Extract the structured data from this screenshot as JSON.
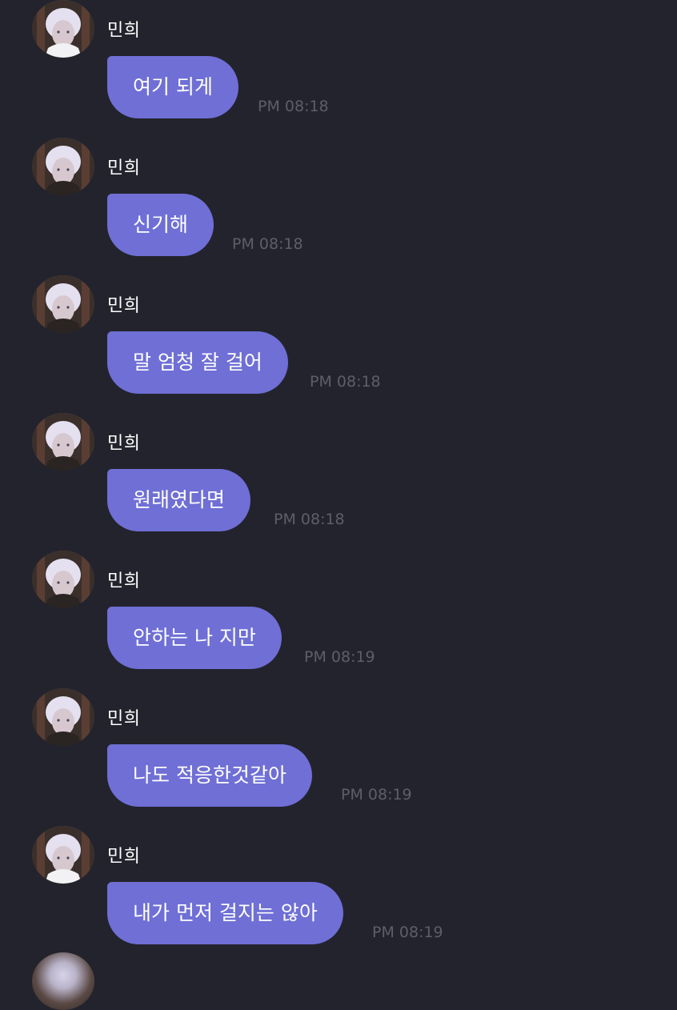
{
  "chat": {
    "messages": [
      {
        "sender": "민희",
        "text": "여기 되게",
        "time": "PM 08:18"
      },
      {
        "sender": "민희",
        "text": "신기해",
        "time": "PM 08:18"
      },
      {
        "sender": "민희",
        "text": "말 엄청 잘 걸어",
        "time": "PM 08:18"
      },
      {
        "sender": "민희",
        "text": "원래였다면",
        "time": "PM 08:18"
      },
      {
        "sender": "민희",
        "text": "안하는 나 지만",
        "time": "PM 08:19"
      },
      {
        "sender": "민희",
        "text": "나도 적응한것같아",
        "time": "PM 08:19"
      },
      {
        "sender": "민희",
        "text": "내가 먼저 걸지는 않아",
        "time": "PM 08:19"
      }
    ]
  },
  "colors": {
    "background": "#23232d",
    "bubble": "#6f6fd6",
    "timestamp": "#5e5e68",
    "text": "#ffffff"
  },
  "icons": {
    "avatar": "profile-photo-avatar"
  }
}
